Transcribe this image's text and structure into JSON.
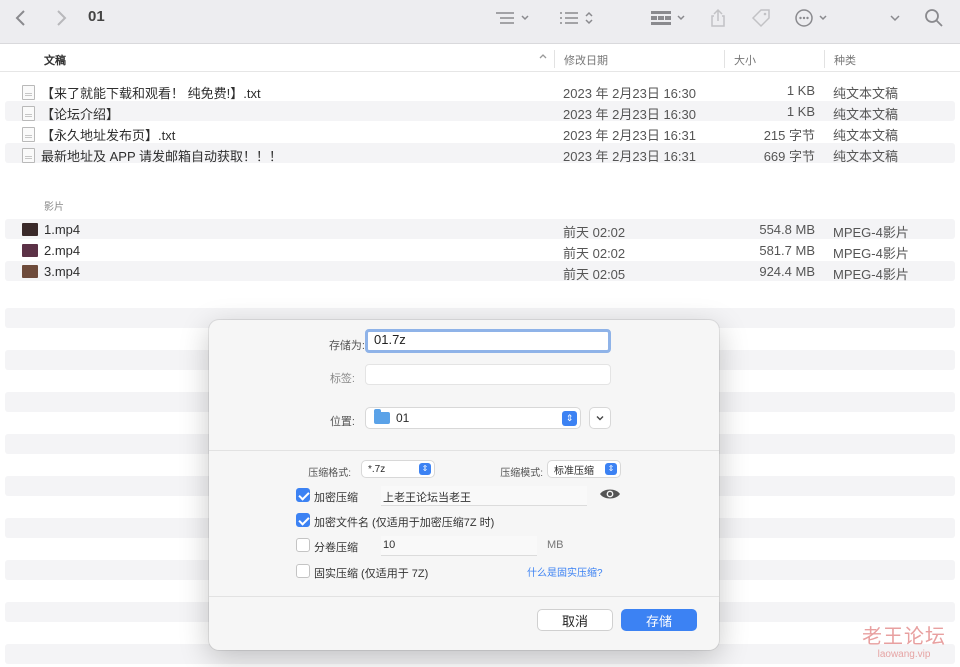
{
  "toolbar": {
    "title": "01",
    "icons": [
      "back-icon",
      "forward-icon",
      "list-view-icon",
      "group-icon",
      "gallery-icon",
      "share-icon",
      "tag-icon",
      "more-icon",
      "chevron-down-icon",
      "search-icon"
    ]
  },
  "columns": {
    "name": "文稿",
    "date": "修改日期",
    "size": "大小",
    "kind": "种类"
  },
  "documents": [
    {
      "name": "【来了就能下载和观看！ 纯免费!】.txt",
      "date": "2023 年 2月23日 16:30",
      "size": "1 KB",
      "kind": "纯文本文稿"
    },
    {
      "name": "【论坛介绍】",
      "date": "2023 年 2月23日 16:30",
      "size": "1 KB",
      "kind": "纯文本文稿"
    },
    {
      "name": "【永久地址发布页】.txt",
      "date": "2023 年 2月23日 16:31",
      "size": "215 字节",
      "kind": "纯文本文稿"
    },
    {
      "name": "最新地址及 APP 请发邮箱自动获取！！！",
      "date": "2023 年 2月23日 16:31",
      "size": "669 字节",
      "kind": "纯文本文稿"
    }
  ],
  "movies_section": "影片",
  "movies": [
    {
      "name": "1.mp4",
      "date": "前天 02:02",
      "size": "554.8 MB",
      "kind": "MPEG-4影片"
    },
    {
      "name": "2.mp4",
      "date": "前天 02:02",
      "size": "581.7 MB",
      "kind": "MPEG-4影片"
    },
    {
      "name": "3.mp4",
      "date": "前天 02:05",
      "size": "924.4 MB",
      "kind": "MPEG-4影片"
    }
  ],
  "dialog": {
    "save_as_label": "存储为:",
    "save_as_value": "01.7z",
    "tags_label": "标签:",
    "tags_value": "",
    "location_label": "位置:",
    "location_value": "01",
    "format_label": "压缩格式:",
    "format_value": "*.7z",
    "mode_label": "压缩模式:",
    "mode_value": "标准压缩",
    "encrypt_label": "加密压缩",
    "encrypt_checked": true,
    "password_value": "上老王论坛当老王",
    "encrypt_names_label": "加密文件名 (仅适用于加密压缩7Z 时)",
    "encrypt_names_checked": true,
    "split_label": "分卷压缩",
    "split_checked": false,
    "split_value": "10",
    "split_unit": "MB",
    "solid_label": "固实压缩 (仅适用于 7Z)",
    "solid_checked": false,
    "solid_help_link": "什么是固实压缩?",
    "cancel_label": "取消",
    "save_label": "存储"
  },
  "watermark": {
    "text": "老王论坛",
    "url": "laowang.vip"
  },
  "colors": {
    "accent": "#3c82f3",
    "toolbar_bg": "#ededf0",
    "stripe": "#f4f4f6"
  }
}
